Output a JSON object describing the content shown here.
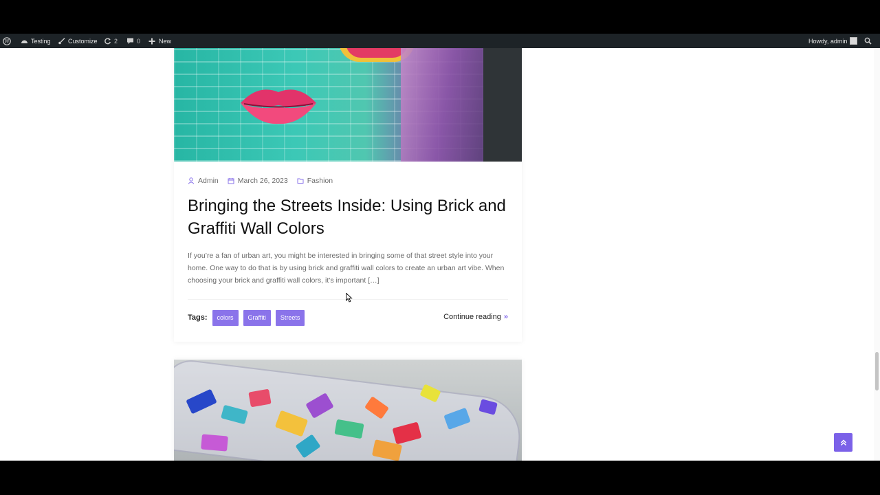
{
  "admin_bar": {
    "site_name": "Testing",
    "customize_label": "Customize",
    "updates_count": "2",
    "comments_count": "0",
    "new_label": "New",
    "howdy": "Howdy, admin"
  },
  "post1": {
    "author": "Admin",
    "date": "March 26, 2023",
    "category": "Fashion",
    "title": "Bringing the Streets Inside: Using Brick and Graffiti Wall Colors",
    "excerpt": "If you’re a fan of urban art, you might be interested in bringing some of that street style into your home. One way to do that is by using brick and graffiti wall colors to create an urban art vibe. When choosing your brick and graffiti wall colors, it’s important […]",
    "tags_label": "Tags:",
    "tags": [
      "colors",
      "Graffiti",
      "Streets"
    ],
    "continue_label": "Continue reading"
  },
  "colors": {
    "accent": "#7b61e8",
    "tag_bg": "#8a73ea",
    "admin_bar_bg": "#1d2327"
  },
  "icons": {
    "wordpress": "wordpress-icon",
    "site": "home-dashboard-icon",
    "customize": "paintbrush-icon",
    "updates": "refresh-icon",
    "comments": "comment-bubble-icon",
    "new": "plus-icon",
    "search": "search-icon",
    "author": "user-icon",
    "date": "calendar-icon",
    "category": "folder-icon",
    "continue": "double-chevron-right-icon",
    "back_to_top": "double-chevron-up-icon"
  }
}
